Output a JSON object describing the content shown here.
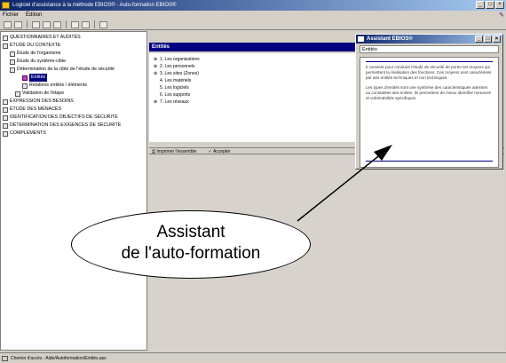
{
  "window": {
    "title": "Logiciel d'assistance à la méthode EBIOS® - Auto-formation EBIOS®",
    "buttons": [
      "_",
      "□",
      "×"
    ]
  },
  "menu": [
    "Fichier",
    "Édition"
  ],
  "tree": {
    "items": [
      {
        "label": "QUESTIONNAIRES ET AUDITÉS",
        "level": 0
      },
      {
        "label": "ÉTUDE DU CONTEXTE",
        "level": 0
      },
      {
        "label": "Étude de l'organisme",
        "level": 1
      },
      {
        "label": "Étude du système-cible",
        "level": 1
      },
      {
        "label": "Détermination de la cible de l'étude de sécurité",
        "level": 1
      },
      {
        "label": "Entités",
        "level": 2,
        "selected": true
      },
      {
        "label": "Relations entités / éléments",
        "level": 2
      },
      {
        "label": "Validation de l'étape",
        "level": 1
      },
      {
        "label": "EXPRESSION DES BESOINS",
        "level": 0
      },
      {
        "label": "ÉTUDE DES MENACES",
        "level": 0
      },
      {
        "label": "IDENTIFICATION DES OBJECTIFS DE SÉCURITÉ",
        "level": 0
      },
      {
        "label": "DÉTERMINATION DES EXIGENCES DE SÉCURITÉ",
        "level": 0
      },
      {
        "label": "COMPLÉMENTS",
        "level": 0
      }
    ]
  },
  "entites": {
    "header": "Entités",
    "items": [
      {
        "label": "1. Les organisations",
        "marker": "⊕"
      },
      {
        "label": "2. Les personnels",
        "marker": "⊕"
      },
      {
        "label": "3. Les sites (Zones)",
        "marker": "⊕"
      },
      {
        "label": "4. Les matériels",
        "marker": ""
      },
      {
        "label": "5. Les logiciels",
        "marker": ""
      },
      {
        "label": "6. Les supports",
        "marker": ""
      },
      {
        "label": "7. Les réseaux",
        "marker": "⊕"
      }
    ]
  },
  "actions": {
    "print": "Imprimer l'ensemble",
    "accept": "Accepter"
  },
  "assistant": {
    "title": "Assistant EBIOS®",
    "subtitle": "Entités",
    "paragraphs": [
      "Il convient pour conduire l'étude de sécurité de porter les moyens qui permettent la réalisation des fonctions. Ces moyens sont caractérisés par des entités techniques et non techniques.",
      "Les types d'entités sont une synthèse des caractéristiques atteintes ou constatées des entités. Ils permettent de mieux identifier menaces et vulnérabilités spécifiques."
    ]
  },
  "callout": {
    "line1": "Assistant",
    "line2": "de l'auto-formation"
  },
  "status": {
    "text": "Chemin d'accès : Aide/Autoformation/Entités.ass"
  },
  "colors": {
    "title_bar": "#0a246a",
    "panel_header": "#000080",
    "selection": "#c040c0"
  }
}
